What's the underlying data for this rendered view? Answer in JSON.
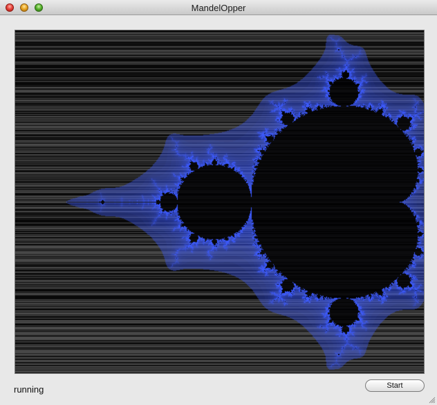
{
  "window": {
    "title": "MandelOpper"
  },
  "main": {
    "status_text": "running",
    "start_label": "Start"
  },
  "colors": {
    "accent": "#4060ff",
    "background": "#e8e8e8"
  }
}
